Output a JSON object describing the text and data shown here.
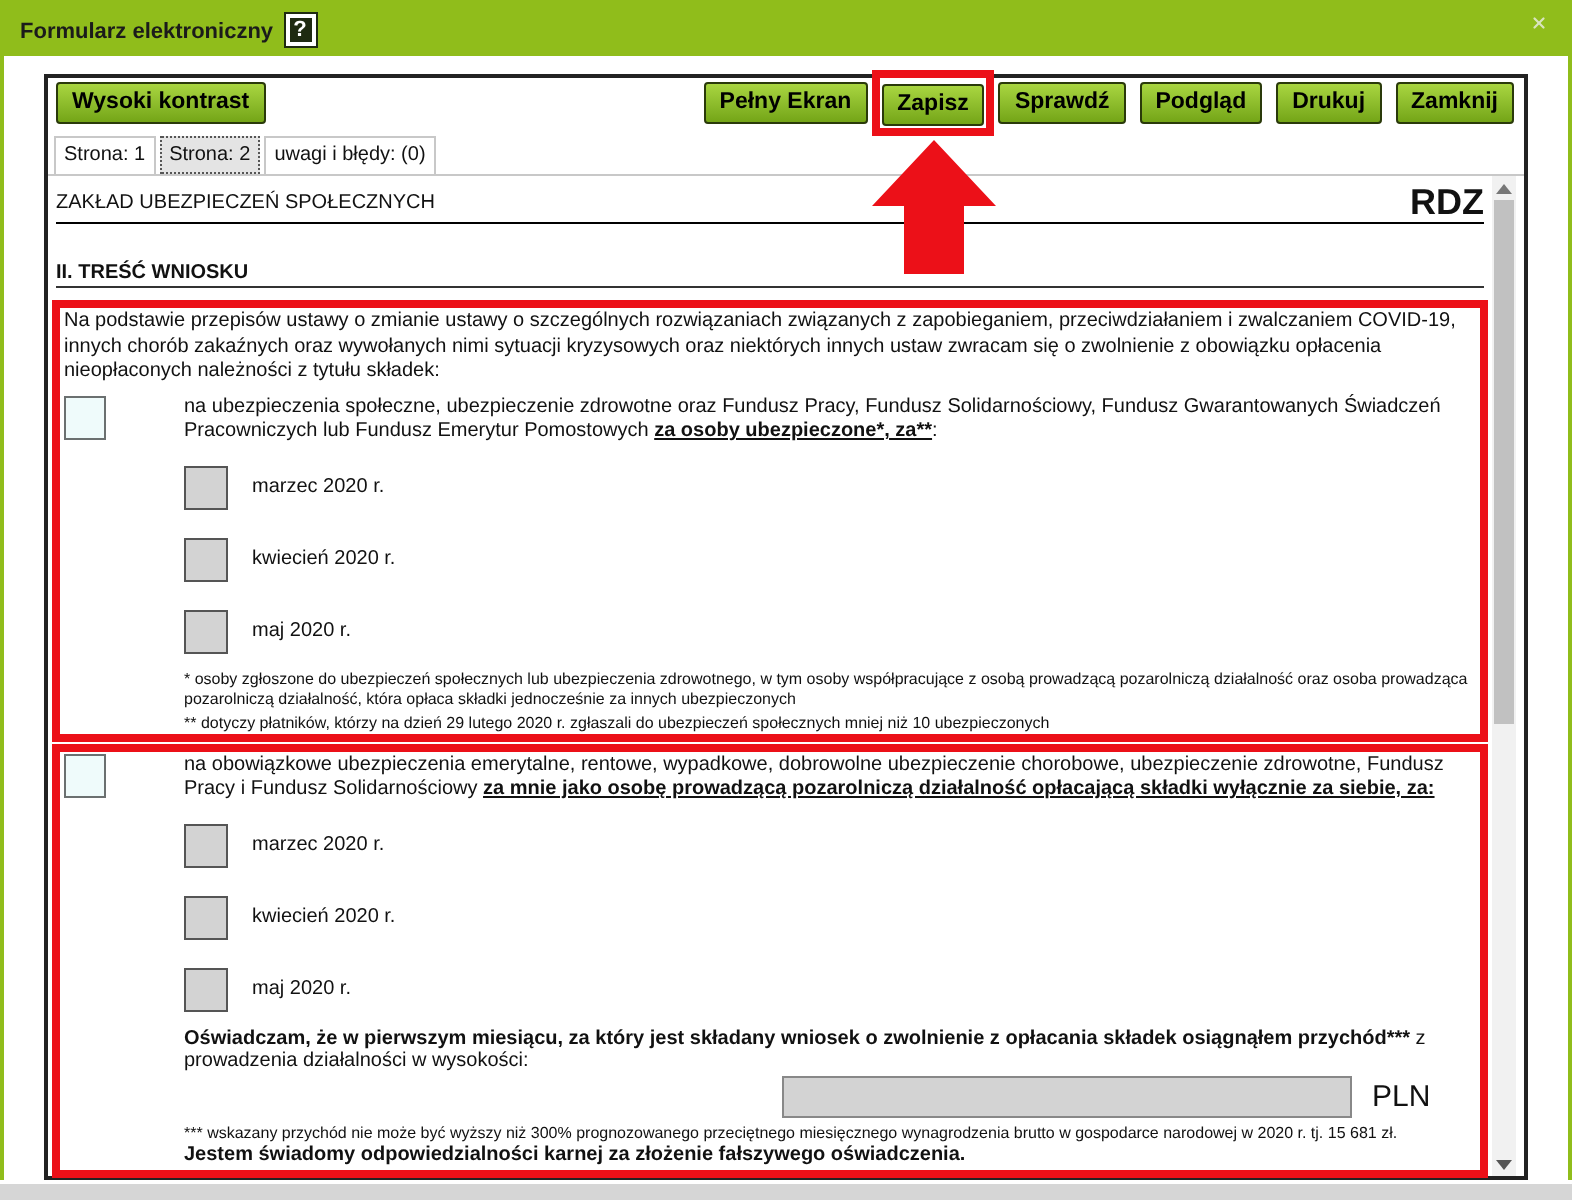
{
  "window": {
    "title": "Formularz elektroniczny",
    "help_label": "?"
  },
  "toolbar": {
    "left_buttons": [
      {
        "label": "Wysoki kontrast",
        "highlighted": false
      }
    ],
    "right_buttons": [
      {
        "label": "Pełny Ekran",
        "highlighted": false
      },
      {
        "label": "Zapisz",
        "highlighted": true
      },
      {
        "label": "Sprawdź",
        "highlighted": false
      },
      {
        "label": "Podgląd",
        "highlighted": false
      },
      {
        "label": "Drukuj",
        "highlighted": false
      },
      {
        "label": "Zamknij",
        "highlighted": false
      }
    ]
  },
  "tabs": [
    {
      "label": "Strona: 1",
      "selected": false
    },
    {
      "label": "Strona: 2",
      "selected": true
    },
    {
      "label": "uwagi i błędy: (0)",
      "selected": false
    }
  ],
  "document": {
    "institution": "ZAKŁAD UBEZPIECZEŃ SPOŁECZNYCH",
    "form_code": "RDZ",
    "section_title": "II. TREŚĆ WNIOSKU",
    "blocks": [
      {
        "highlighted": true,
        "intro": "Na podstawie przepisów ustawy o zmianie ustawy o szczególnych rozwiązaniach związanych z zapobieganiem, przeciwdziałaniem i zwalczaniem COVID-19, innych chorób zakaźnych oraz wywołanych nimi sytuacji kryzysowych oraz niektórych innych ustaw zwracam się o zwolnienie z obowiązku opłacenia nieopłaconych należności z tytułu składek:",
        "option": {
          "checked": false,
          "segments": [
            {
              "text": "na ubezpieczenia społeczne, ubezpieczenie zdrowotne oraz Fundusz Pracy, Fundusz Solidarnościowy, Fundusz Gwarantowanych Świadczeń Pracowniczych lub Fundusz Emerytur Pomostowych ",
              "kind": "normal"
            },
            {
              "text": "za osoby ubezpieczone*, za**",
              "kind": "bold-underline"
            },
            {
              "text": ":",
              "kind": "normal"
            }
          ]
        },
        "months": [
          {
            "label": "marzec 2020 r.",
            "checked": false
          },
          {
            "label": "kwiecień 2020 r.",
            "checked": false
          },
          {
            "label": "maj 2020 r.",
            "checked": false
          }
        ],
        "footnotes": [
          "* osoby zgłoszone do ubezpieczeń społecznych lub ubezpieczenia zdrowotnego, w tym osoby współpracujące z osobą prowadzącą pozarolniczą działalność oraz osoba prowadząca pozarolniczą działalność, która opłaca składki jednocześnie za innych ubezpieczonych",
          "** dotyczy płatników, którzy na dzień 29 lutego 2020 r. zgłaszali do ubezpieczeń społecznych mniej niż 10 ubezpieczonych"
        ]
      },
      {
        "highlighted": true,
        "option": {
          "checked": false,
          "segments": [
            {
              "text": "na obowiązkowe ubezpieczenia emerytalne, rentowe, wypadkowe, dobrowolne ubezpieczenie chorobowe, ubezpieczenie zdrowotne, Fundusz Pracy i Fundusz Solidarnościowy ",
              "kind": "normal"
            },
            {
              "text": "za mnie jako osobę prowadzącą pozarolniczą działalność opłacającą składki wyłącznie za siebie, za:",
              "kind": "bold-underline"
            }
          ]
        },
        "months": [
          {
            "label": "marzec 2020 r.",
            "checked": false
          },
          {
            "label": "kwiecień 2020 r.",
            "checked": false
          },
          {
            "label": "maj 2020 r.",
            "checked": false
          }
        ],
        "declaration": {
          "segments": [
            {
              "text": "Oświadczam, że w pierwszym miesiącu, za który jest składany wniosek o zwolnienie z opłacania składek osiągnąłem przychód***",
              "kind": "bold"
            },
            {
              "text": " z prowadzenia działalności w wysokości:",
              "kind": "normal"
            }
          ],
          "currency": "PLN"
        },
        "footnotes": [
          "*** wskazany przychód nie może być wyższy niż 300% prognozowanego przeciętnego miesięcznego wynagrodzenia brutto w gospodarce narodowej w 2020 r. tj. 15 681 zł."
        ],
        "closing": "Jestem świadomy odpowiedzialności karnej za złożenie fałszywego oświadczenia."
      }
    ]
  }
}
